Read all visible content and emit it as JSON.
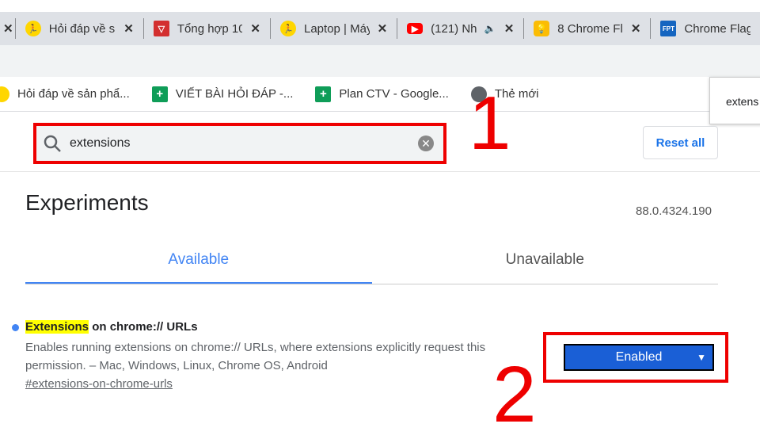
{
  "tabs": [
    {
      "title": "Hỏi đáp về s",
      "icon": "runner-yellow-icon"
    },
    {
      "title": "Tổng hợp 10",
      "icon": "red-v-icon"
    },
    {
      "title": "Laptop | Máy",
      "icon": "runner-yellow-icon"
    },
    {
      "title": "(121) Nh",
      "icon": "youtube-icon"
    },
    {
      "title": "8 Chrome Fl",
      "icon": "bulb-icon"
    },
    {
      "title": "Chrome Flag",
      "icon": "fpt-icon"
    }
  ],
  "bookmarks": [
    {
      "label": "Hỏi đáp về sản phẩ...",
      "icon": "runner-yellow-icon"
    },
    {
      "label": "VIẾT BÀI HỎI ĐÁP -...",
      "icon": "sheets-icon"
    },
    {
      "label": "Plan CTV - Google...",
      "icon": "sheets-icon"
    },
    {
      "label": "Thẻ mới",
      "icon": "globe-icon"
    }
  ],
  "popup_text": "extens",
  "search": {
    "value": "extensions"
  },
  "reset_label": "Reset all",
  "annotations": {
    "one": "1",
    "two": "2",
    "color": "#ee0000"
  },
  "page": {
    "title": "Experiments",
    "version": "88.0.4324.190"
  },
  "page_tabs": {
    "available": "Available",
    "unavailable": "Unavailable"
  },
  "experiment": {
    "title_highlight": "Extensions",
    "title_rest": " on chrome:// URLs",
    "description": "Enables running extensions on chrome:// URLs, where extensions explicitly request this permission. – Mac, Windows, Linux, Chrome OS, Android",
    "link": "#extensions-on-chrome-urls",
    "state": "Enabled"
  }
}
